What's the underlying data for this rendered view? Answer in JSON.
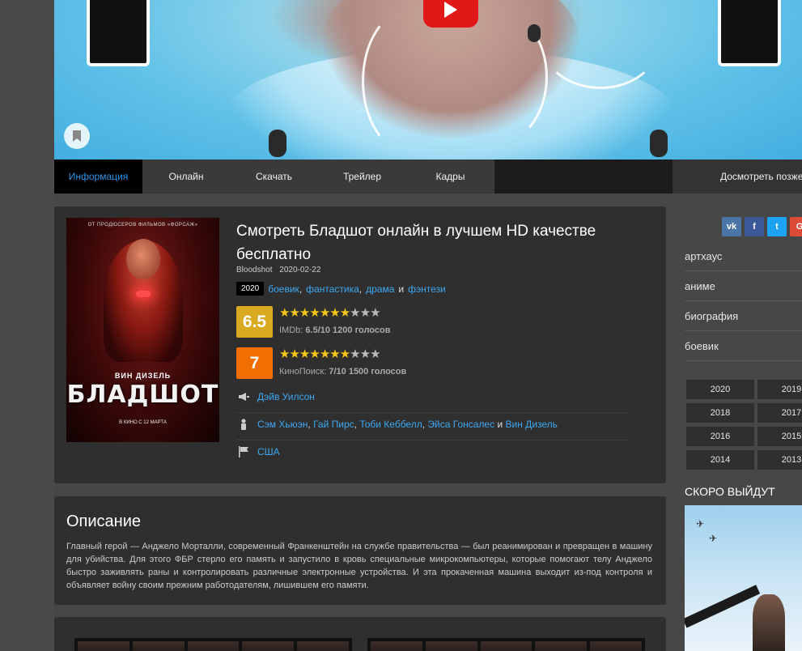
{
  "tabs": [
    "Информация",
    "Онлайн",
    "Скачать",
    "Трейлер",
    "Кадры"
  ],
  "later_label": "Досмотреть позже",
  "poster": {
    "top_text": "ОТ ПРОДЮСЕРОВ ФИЛЬМОВ «ФОРСАЖ»",
    "actor": "ВИН ДИЗЕЛЬ",
    "name": "БЛАДШОТ",
    "release": "В КИНО С 12 МАРТА"
  },
  "movie": {
    "title": "Смотреть Бладшот онлайн в лучшем HD качестве бесплатно",
    "original_title": "Bloodshot",
    "date": "2020-02-22",
    "year": "2020",
    "genres": [
      "боевик",
      "фантастика",
      "драма",
      "фэнтези"
    ],
    "and_word": "и",
    "comma": ",",
    "imdb": {
      "score": "6.5",
      "label": "IMDb:",
      "value": "6.5/10 1200 голосов",
      "stars_on": 6.5,
      "stars_total": 10
    },
    "kp": {
      "score": "7",
      "label": "КиноПоиск:",
      "value": "7/10 1500 голосов",
      "stars_on": 7,
      "stars_total": 10
    },
    "director": "Дэйв Уилсон",
    "cast": [
      "Сэм Хьюэн",
      "Гай Пирс",
      "Тоби Кеббелл",
      "Эйса Гонсалес",
      "Вин Дизель"
    ],
    "country": "США"
  },
  "description": {
    "heading": "Описание",
    "text": "Главный герой — Анджело Морталли, современный Франкенштейн на службе правительства — был реанимирован и превращен в машину для убийства. Для этого ФБР стерло его память и запустило в кровь специальные микрокомпьютеры, которые помогают телу Анджело быстро заживлять раны и контролировать различные электронные устройства. И эта прокаченная машина выходит из-под контроля и объявляет войну своим прежним работодателям, лишившем его памяти."
  },
  "social": [
    "vk",
    "f",
    "t",
    "G"
  ],
  "sidebar_genres": [
    "артхаус",
    "аниме",
    "биография",
    "боевик"
  ],
  "years": [
    "2020",
    "2019",
    "2018",
    "2017",
    "2016",
    "2015",
    "2014",
    "2013"
  ],
  "soon": {
    "title": "СКОРО ВЫЙДУТ"
  }
}
